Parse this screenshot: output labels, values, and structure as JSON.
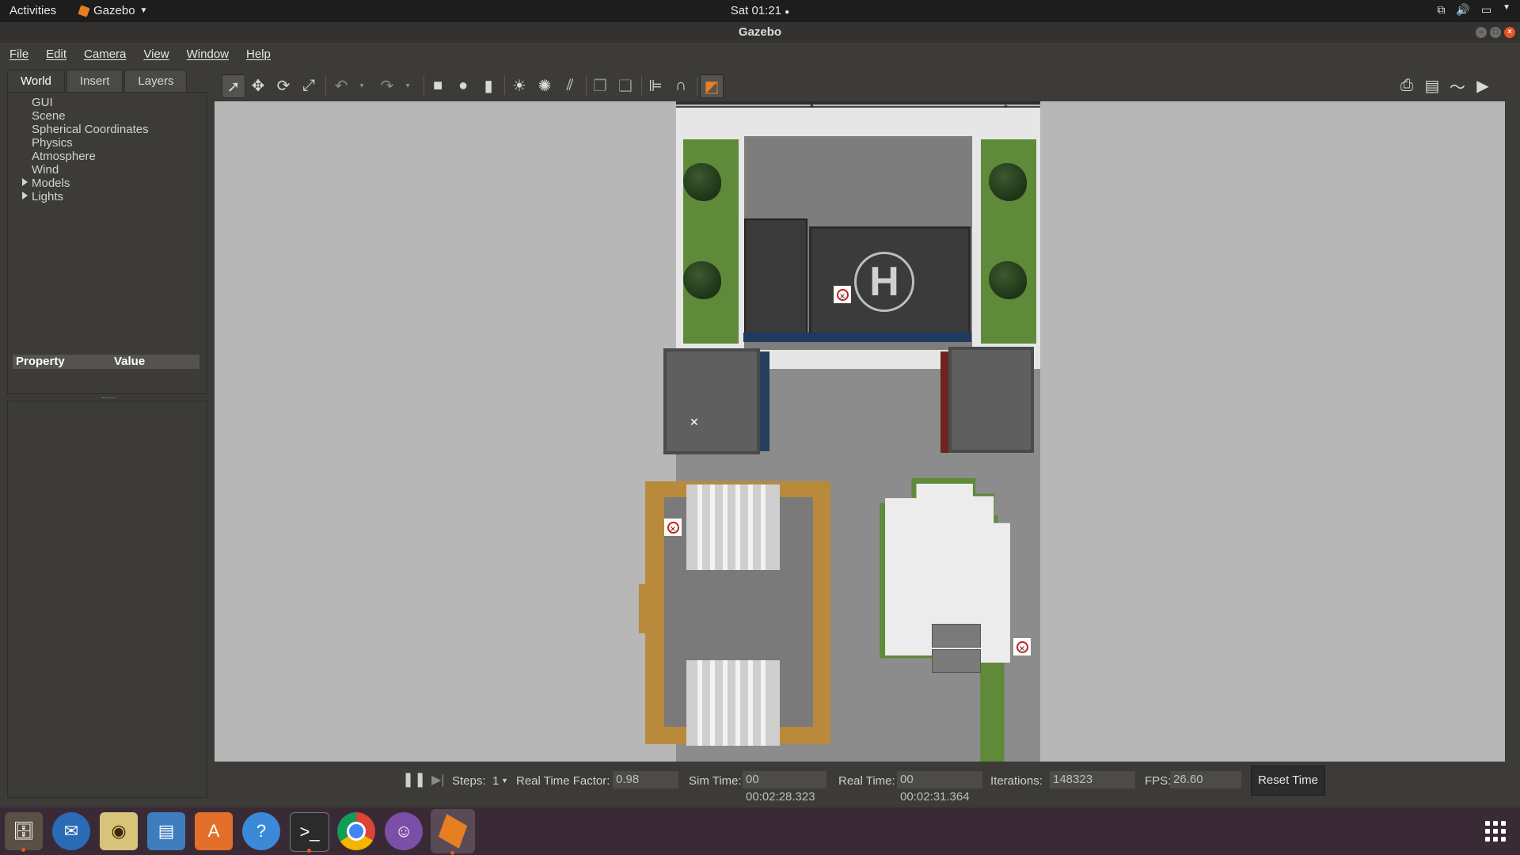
{
  "topbar": {
    "activities": "Activities",
    "app_name": "Gazebo",
    "clock": "Sat 01:21",
    "clock_dot": "●",
    "tray": [
      "network-icon",
      "volume-icon",
      "battery-icon",
      "chevron-down-icon"
    ]
  },
  "window": {
    "title": "Gazebo"
  },
  "menu": [
    "File",
    "Edit",
    "Camera",
    "View",
    "Window",
    "Help"
  ],
  "left_panel": {
    "tabs": [
      "World",
      "Insert",
      "Layers"
    ],
    "active_tab": "World",
    "tree": [
      {
        "label": "GUI",
        "expandable": false
      },
      {
        "label": "Scene",
        "expandable": false
      },
      {
        "label": "Spherical Coordinates",
        "expandable": false
      },
      {
        "label": "Physics",
        "expandable": false
      },
      {
        "label": "Atmosphere",
        "expandable": false
      },
      {
        "label": "Wind",
        "expandable": false
      },
      {
        "label": "Models",
        "expandable": true
      },
      {
        "label": "Lights",
        "expandable": true
      }
    ],
    "property_header": {
      "property": "Property",
      "value": "Value"
    }
  },
  "toolbar": {
    "tools": [
      "select-arrow-icon",
      "translate-icon",
      "rotate-icon",
      "scale-icon",
      "undo-icon",
      "redo-icon",
      "box-icon",
      "sphere-icon",
      "cylinder-icon",
      "point-light-icon",
      "spot-light-icon",
      "directional-light-icon",
      "copy-icon",
      "paste-icon",
      "align-icon",
      "snap-icon",
      "view-angle-icon"
    ],
    "right_tools": [
      "screenshot-icon",
      "log-icon",
      "plot-icon",
      "record-icon"
    ]
  },
  "sim": {
    "steps_label": "Steps:",
    "steps_value": "1",
    "rtf_label": "Real Time Factor:",
    "rtf_value": "0.98",
    "sim_time_label": "Sim Time:",
    "sim_time_value": "00 00:02:28.323",
    "real_time_label": "Real Time:",
    "real_time_value": "00 00:02:31.364",
    "iterations_label": "Iterations:",
    "iterations_value": "148323",
    "fps_label": "FPS:",
    "fps_value": "26.60",
    "reset_label": "Reset Time"
  },
  "scene": {
    "helipad_letter": "H"
  },
  "dock": [
    "files-icon",
    "thunderbird-icon",
    "rhythmbox-icon",
    "writer-icon",
    "software-center-icon",
    "help-icon",
    "terminal-icon",
    "chrome-icon",
    "github-desktop-icon",
    "gazebo-icon"
  ],
  "colors": {
    "accent": "#e95420",
    "panel_bg": "#3c3b37",
    "scene_ground": "#b7b7b7",
    "grass": "#5e8a3a"
  }
}
